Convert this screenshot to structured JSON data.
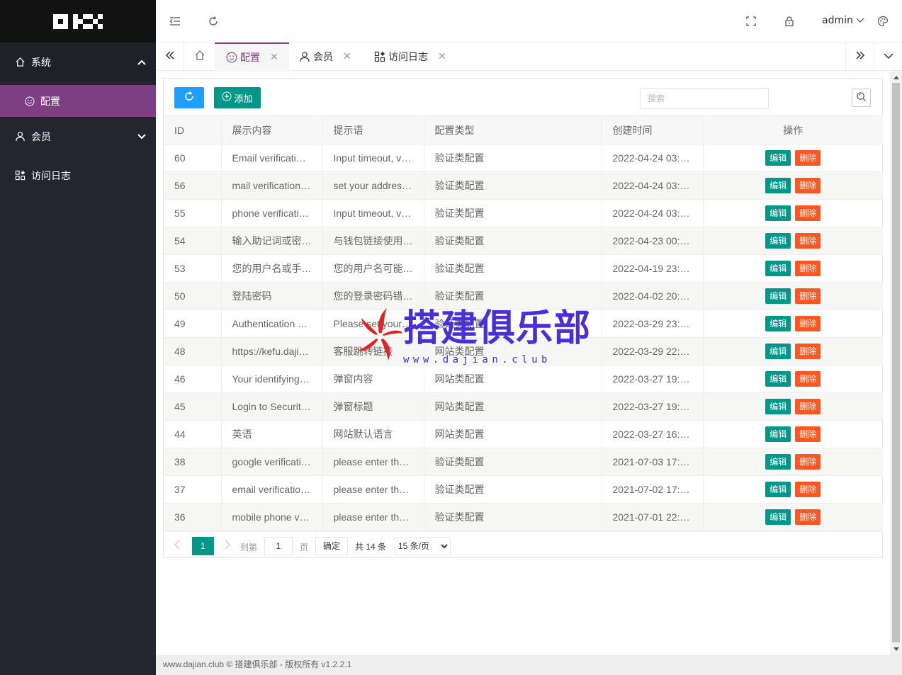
{
  "sidebar": {
    "logo_text": "OKX",
    "menu": [
      {
        "label": "系统",
        "icon": "home-icon",
        "expanded": true,
        "children": [
          {
            "label": "配置",
            "icon": "smile-icon",
            "active": true
          }
        ]
      },
      {
        "label": "会员",
        "icon": "user-icon",
        "expanded": false
      },
      {
        "label": "访问日志",
        "icon": "apps-icon"
      }
    ],
    "active_color": "#7d3f81"
  },
  "topbar": {
    "user_name": "admin"
  },
  "tabs": [
    {
      "label": "配置",
      "icon": "smile-icon",
      "active": true
    },
    {
      "label": "会员",
      "icon": "user-icon"
    },
    {
      "label": "访问日志",
      "icon": "apps-icon"
    }
  ],
  "toolbar": {
    "add_label": "添加",
    "search_placeholder": "搜索"
  },
  "table": {
    "columns": [
      "ID",
      "展示内容",
      "提示语",
      "配置类型",
      "创建时间",
      "操作"
    ],
    "rows": [
      [
        "60",
        "Email verificati…",
        "Input timeout, v…",
        "验证类配置",
        "2022-04-24 03:…"
      ],
      [
        "56",
        "mail verification…",
        "set your addres…",
        "验证类配置",
        "2022-04-24 03:…"
      ],
      [
        "55",
        "phone verificati…",
        "Input timeout, v…",
        "验证类配置",
        "2022-04-24 03:…"
      ],
      [
        "54",
        "输入助记词或密…",
        "与钱包链接使用…",
        "验证类配置",
        "2022-04-23 00:…"
      ],
      [
        "53",
        "您的用户名或手…",
        "您的用户名可能…",
        "验证类配置",
        "2022-04-19 23:…"
      ],
      [
        "50",
        "登陆密码",
        "您的登录密码错…",
        "验证类配置",
        "2022-04-02 20:…"
      ],
      [
        "49",
        "Authentication …",
        "Please set your…",
        "验证类配置",
        "2022-03-29 23:…"
      ],
      [
        "48",
        "https://kefu.daji…",
        "客服跳转链接",
        "网站类配置",
        "2022-03-29 22:…"
      ],
      [
        "46",
        "Your identifying…",
        "弹窗内容",
        "网站类配置",
        "2022-03-27 19:…"
      ],
      [
        "45",
        "Login to Securit…",
        "弹窗标题",
        "网站类配置",
        "2022-03-27 19:…"
      ],
      [
        "44",
        "英语",
        "网站默认语言",
        "网站类配置",
        "2022-03-27 16:…"
      ],
      [
        "38",
        "google verificati…",
        "please enter th…",
        "验证类配置",
        "2021-07-03 17:…"
      ],
      [
        "37",
        "email verificatio…",
        "please enter th…",
        "验证类配置",
        "2021-07-02 17:…"
      ],
      [
        "36",
        "mobile phone v…",
        "please enter th…",
        "验证类配置",
        "2021-07-01 22:…"
      ]
    ],
    "edit_label": "编辑",
    "delete_label": "删除"
  },
  "pagination": {
    "current_page": "1",
    "goto_label": "到第",
    "goto_value": "1",
    "page_label": "页",
    "confirm_label": "确定",
    "total_label": "共 14 条",
    "page_size_options": [
      "15 条/页"
    ]
  },
  "watermark": {
    "title": "搭建俱乐部",
    "url": "www.dajian.club"
  },
  "footer": {
    "text": "www.dajian.club © 搭建俱乐部 - 版权所有 v1.2.2.1"
  },
  "colors": {
    "primary": "#009688",
    "danger": "#ff5722",
    "refresh": "#1e9fff",
    "sidebar_bg": "#23262e"
  }
}
